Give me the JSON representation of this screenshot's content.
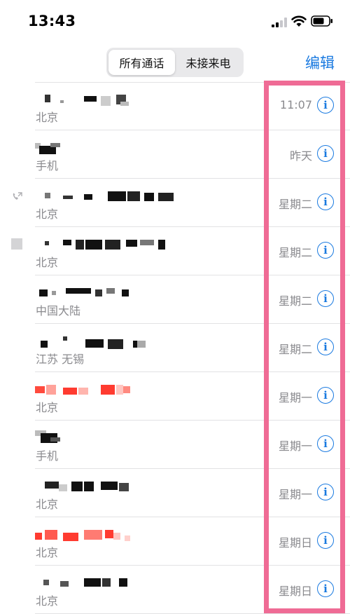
{
  "status_bar": {
    "time": "13:43"
  },
  "nav": {
    "segments": [
      "所有通话",
      "未接来电"
    ],
    "active_segment": "所有通话",
    "edit_label": "编辑"
  },
  "colors": {
    "accent": "#1a7ae0",
    "missed": "#ff3b30",
    "highlight": "#ef6b95"
  },
  "calls": [
    {
      "location": "北京",
      "date": "11:07",
      "missed": false
    },
    {
      "location": "手机",
      "date": "昨天",
      "missed": false
    },
    {
      "location": "北京",
      "date": "星期二",
      "missed": false
    },
    {
      "location": "北京",
      "date": "星期二",
      "missed": false
    },
    {
      "location": "中国大陆",
      "date": "星期二",
      "missed": false
    },
    {
      "location": "江苏 无锡",
      "date": "星期二",
      "missed": false
    },
    {
      "location": "北京",
      "date": "星期一",
      "missed": true
    },
    {
      "location": "手机",
      "date": "星期一",
      "missed": false
    },
    {
      "location": "北京",
      "date": "星期一",
      "missed": false
    },
    {
      "location": "北京",
      "date": "星期日",
      "missed": true
    },
    {
      "location": "北京",
      "date": "星期日",
      "missed": false
    }
  ],
  "info_icon_glyph": "i"
}
